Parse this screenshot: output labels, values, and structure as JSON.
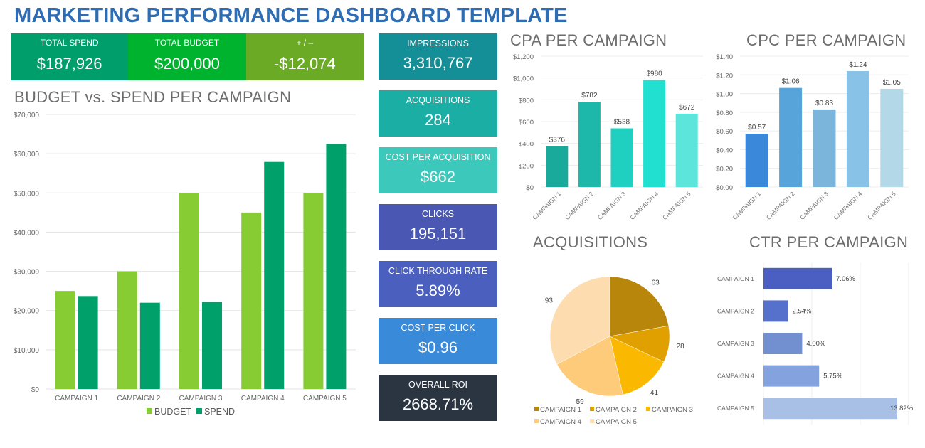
{
  "page": {
    "title": "MARKETING PERFORMANCE DASHBOARD TEMPLATE"
  },
  "summary": [
    {
      "label": "TOTAL SPEND",
      "value": "$187,926",
      "color": "#009e6b"
    },
    {
      "label": "TOTAL BUDGET",
      "value": "$200,000",
      "color": "#00b32f"
    },
    {
      "label": "+ / –",
      "value": "-$12,074",
      "color": "#6aaa24"
    }
  ],
  "kpis": [
    {
      "label": "IMPRESSIONS",
      "value": "3,310,767",
      "color": "#148f97"
    },
    {
      "label": "ACQUISITIONS",
      "value": "284",
      "color": "#1aaea5"
    },
    {
      "label": "COST PER ACQUISITION",
      "value": "$662",
      "color": "#3cc9bb"
    },
    {
      "label": "CLICKS",
      "value": "195,151",
      "color": "#4a58b4"
    },
    {
      "label": "CLICK THROUGH RATE",
      "value": "5.89%",
      "color": "#4b5fbf"
    },
    {
      "label": "COST PER CLICK",
      "value": "$0.96",
      "color": "#398ad9"
    },
    {
      "label": "OVERALL ROI",
      "value": "2668.71%",
      "color": "#2b3441"
    }
  ],
  "chart_data": [
    {
      "id": "budget_vs_spend",
      "type": "bar",
      "title": "BUDGET vs. SPEND PER CAMPAIGN",
      "categories": [
        "CAMPAIGN 1",
        "CAMPAIGN 2",
        "CAMPAIGN 3",
        "CAMPAIGN 4",
        "CAMPAIGN 5"
      ],
      "series": [
        {
          "name": "BUDGET",
          "values": [
            25000,
            30000,
            50000,
            45000,
            50000
          ],
          "color": "#86cc32"
        },
        {
          "name": "SPEND",
          "values": [
            23700,
            22000,
            22200,
            57900,
            62500
          ],
          "color": "#00a06b"
        }
      ],
      "ylim": [
        0,
        70000
      ],
      "yticks": [
        0,
        10000,
        20000,
        30000,
        40000,
        50000,
        60000,
        70000
      ],
      "ytick_labels": [
        "$0",
        "$10,000",
        "$20,000",
        "$30,000",
        "$40,000",
        "$50,000",
        "$60,000",
        "$70,000"
      ],
      "grid": true,
      "legend": "bottom",
      "xlabel": "",
      "ylabel": ""
    },
    {
      "id": "cpa",
      "type": "bar",
      "title": "CPA PER CAMPAIGN",
      "categories": [
        "CAMPAIGN 1",
        "CAMPAIGN 2",
        "CAMPAIGN 3",
        "CAMPAIGN 4",
        "CAMPAIGN 5"
      ],
      "values": [
        376,
        782,
        538,
        980,
        672
      ],
      "data_labels": [
        "$376",
        "$782",
        "$538",
        "$980",
        "$672"
      ],
      "colors": [
        "#1aaa9c",
        "#1db8aa",
        "#1fcfbf",
        "#22e0d0",
        "#5ce5da"
      ],
      "ylim": [
        0,
        1200
      ],
      "yticks": [
        0,
        200,
        400,
        600,
        800,
        1000,
        1200
      ],
      "ytick_labels": [
        "$0",
        "$200",
        "$400",
        "$600",
        "$800",
        "$1,000",
        "$1,200"
      ],
      "grid": true,
      "xlabel": "",
      "ylabel": ""
    },
    {
      "id": "cpc",
      "type": "bar",
      "title": "CPC PER CAMPAIGN",
      "categories": [
        "CAMPAIGN 1",
        "CAMPAIGN 2",
        "CAMPAIGN 3",
        "CAMPAIGN 4",
        "CAMPAIGN 5"
      ],
      "values": [
        0.57,
        1.06,
        0.83,
        1.24,
        1.05
      ],
      "data_labels": [
        "$0.57",
        "$1.06",
        "$0.83",
        "$1.24",
        "$1.05"
      ],
      "colors": [
        "#3a88da",
        "#57a4da",
        "#7cb5db",
        "#88c2e6",
        "#b3d8e8"
      ],
      "ylim": [
        0,
        1.4
      ],
      "yticks": [
        0,
        0.2,
        0.4,
        0.6,
        0.8,
        1.0,
        1.2,
        1.4
      ],
      "ytick_labels": [
        "$0.00",
        "$0.20",
        "$0.40",
        "$0.60",
        "$0.80",
        "$1.00",
        "$1.20",
        "$1.40"
      ],
      "grid": true,
      "xlabel": "",
      "ylabel": ""
    },
    {
      "id": "acquisitions",
      "type": "pie",
      "title": "ACQUISITIONS",
      "categories": [
        "CAMPAIGN 1",
        "CAMPAIGN 2",
        "CAMPAIGN 3",
        "CAMPAIGN 4",
        "CAMPAIGN 5"
      ],
      "values": [
        63,
        28,
        41,
        59,
        93
      ],
      "data_labels": [
        "63",
        "28",
        "41",
        "59",
        "93"
      ],
      "colors": [
        "#b8860b",
        "#dfa000",
        "#fbb800",
        "#fdcb7a",
        "#fddcaf"
      ],
      "legend": "bottom"
    },
    {
      "id": "ctr",
      "type": "bar",
      "orientation": "horizontal",
      "title": "CTR PER CAMPAIGN",
      "categories": [
        "CAMPAIGN 1",
        "CAMPAIGN 2",
        "CAMPAIGN 3",
        "CAMPAIGN 4",
        "CAMPAIGN 5"
      ],
      "values": [
        7.06,
        2.54,
        4.0,
        5.75,
        13.82
      ],
      "data_labels": [
        "7.06%",
        "2.54%",
        "4.00%",
        "5.75%",
        "13.82%"
      ],
      "colors": [
        "#4a5fc1",
        "#5571cc",
        "#7290d0",
        "#84a2de",
        "#a9c0e6"
      ],
      "xlim": [
        0,
        15
      ],
      "grid": true,
      "xlabel": "",
      "ylabel": ""
    }
  ]
}
